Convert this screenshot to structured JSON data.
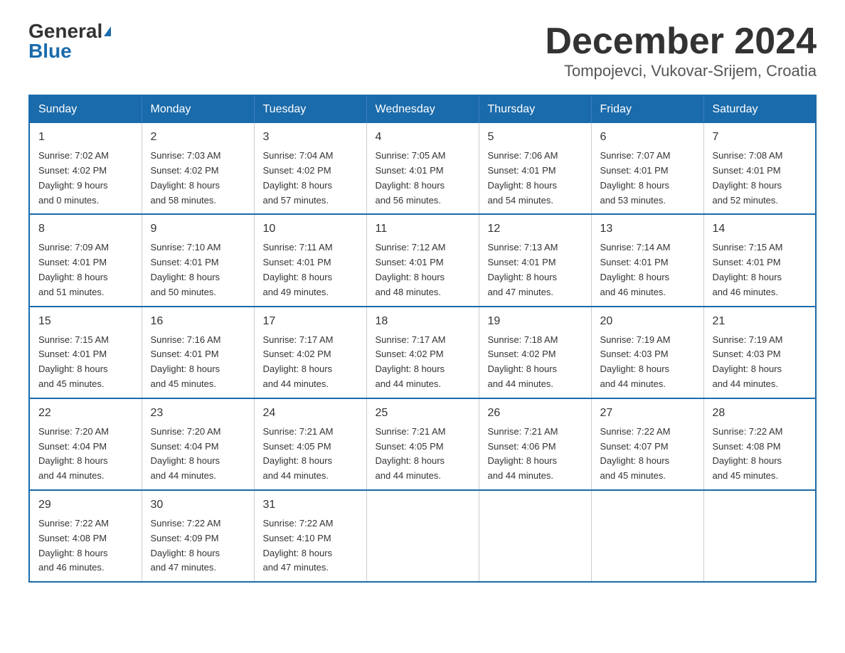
{
  "logo": {
    "general": "General",
    "blue": "Blue"
  },
  "title": "December 2024",
  "subtitle": "Tompojevci, Vukovar-Srijem, Croatia",
  "headers": [
    "Sunday",
    "Monday",
    "Tuesday",
    "Wednesday",
    "Thursday",
    "Friday",
    "Saturday"
  ],
  "weeks": [
    [
      {
        "day": "1",
        "sunrise": "Sunrise: 7:02 AM",
        "sunset": "Sunset: 4:02 PM",
        "daylight": "Daylight: 9 hours",
        "daylight2": "and 0 minutes."
      },
      {
        "day": "2",
        "sunrise": "Sunrise: 7:03 AM",
        "sunset": "Sunset: 4:02 PM",
        "daylight": "Daylight: 8 hours",
        "daylight2": "and 58 minutes."
      },
      {
        "day": "3",
        "sunrise": "Sunrise: 7:04 AM",
        "sunset": "Sunset: 4:02 PM",
        "daylight": "Daylight: 8 hours",
        "daylight2": "and 57 minutes."
      },
      {
        "day": "4",
        "sunrise": "Sunrise: 7:05 AM",
        "sunset": "Sunset: 4:01 PM",
        "daylight": "Daylight: 8 hours",
        "daylight2": "and 56 minutes."
      },
      {
        "day": "5",
        "sunrise": "Sunrise: 7:06 AM",
        "sunset": "Sunset: 4:01 PM",
        "daylight": "Daylight: 8 hours",
        "daylight2": "and 54 minutes."
      },
      {
        "day": "6",
        "sunrise": "Sunrise: 7:07 AM",
        "sunset": "Sunset: 4:01 PM",
        "daylight": "Daylight: 8 hours",
        "daylight2": "and 53 minutes."
      },
      {
        "day": "7",
        "sunrise": "Sunrise: 7:08 AM",
        "sunset": "Sunset: 4:01 PM",
        "daylight": "Daylight: 8 hours",
        "daylight2": "and 52 minutes."
      }
    ],
    [
      {
        "day": "8",
        "sunrise": "Sunrise: 7:09 AM",
        "sunset": "Sunset: 4:01 PM",
        "daylight": "Daylight: 8 hours",
        "daylight2": "and 51 minutes."
      },
      {
        "day": "9",
        "sunrise": "Sunrise: 7:10 AM",
        "sunset": "Sunset: 4:01 PM",
        "daylight": "Daylight: 8 hours",
        "daylight2": "and 50 minutes."
      },
      {
        "day": "10",
        "sunrise": "Sunrise: 7:11 AM",
        "sunset": "Sunset: 4:01 PM",
        "daylight": "Daylight: 8 hours",
        "daylight2": "and 49 minutes."
      },
      {
        "day": "11",
        "sunrise": "Sunrise: 7:12 AM",
        "sunset": "Sunset: 4:01 PM",
        "daylight": "Daylight: 8 hours",
        "daylight2": "and 48 minutes."
      },
      {
        "day": "12",
        "sunrise": "Sunrise: 7:13 AM",
        "sunset": "Sunset: 4:01 PM",
        "daylight": "Daylight: 8 hours",
        "daylight2": "and 47 minutes."
      },
      {
        "day": "13",
        "sunrise": "Sunrise: 7:14 AM",
        "sunset": "Sunset: 4:01 PM",
        "daylight": "Daylight: 8 hours",
        "daylight2": "and 46 minutes."
      },
      {
        "day": "14",
        "sunrise": "Sunrise: 7:15 AM",
        "sunset": "Sunset: 4:01 PM",
        "daylight": "Daylight: 8 hours",
        "daylight2": "and 46 minutes."
      }
    ],
    [
      {
        "day": "15",
        "sunrise": "Sunrise: 7:15 AM",
        "sunset": "Sunset: 4:01 PM",
        "daylight": "Daylight: 8 hours",
        "daylight2": "and 45 minutes."
      },
      {
        "day": "16",
        "sunrise": "Sunrise: 7:16 AM",
        "sunset": "Sunset: 4:01 PM",
        "daylight": "Daylight: 8 hours",
        "daylight2": "and 45 minutes."
      },
      {
        "day": "17",
        "sunrise": "Sunrise: 7:17 AM",
        "sunset": "Sunset: 4:02 PM",
        "daylight": "Daylight: 8 hours",
        "daylight2": "and 44 minutes."
      },
      {
        "day": "18",
        "sunrise": "Sunrise: 7:17 AM",
        "sunset": "Sunset: 4:02 PM",
        "daylight": "Daylight: 8 hours",
        "daylight2": "and 44 minutes."
      },
      {
        "day": "19",
        "sunrise": "Sunrise: 7:18 AM",
        "sunset": "Sunset: 4:02 PM",
        "daylight": "Daylight: 8 hours",
        "daylight2": "and 44 minutes."
      },
      {
        "day": "20",
        "sunrise": "Sunrise: 7:19 AM",
        "sunset": "Sunset: 4:03 PM",
        "daylight": "Daylight: 8 hours",
        "daylight2": "and 44 minutes."
      },
      {
        "day": "21",
        "sunrise": "Sunrise: 7:19 AM",
        "sunset": "Sunset: 4:03 PM",
        "daylight": "Daylight: 8 hours",
        "daylight2": "and 44 minutes."
      }
    ],
    [
      {
        "day": "22",
        "sunrise": "Sunrise: 7:20 AM",
        "sunset": "Sunset: 4:04 PM",
        "daylight": "Daylight: 8 hours",
        "daylight2": "and 44 minutes."
      },
      {
        "day": "23",
        "sunrise": "Sunrise: 7:20 AM",
        "sunset": "Sunset: 4:04 PM",
        "daylight": "Daylight: 8 hours",
        "daylight2": "and 44 minutes."
      },
      {
        "day": "24",
        "sunrise": "Sunrise: 7:21 AM",
        "sunset": "Sunset: 4:05 PM",
        "daylight": "Daylight: 8 hours",
        "daylight2": "and 44 minutes."
      },
      {
        "day": "25",
        "sunrise": "Sunrise: 7:21 AM",
        "sunset": "Sunset: 4:05 PM",
        "daylight": "Daylight: 8 hours",
        "daylight2": "and 44 minutes."
      },
      {
        "day": "26",
        "sunrise": "Sunrise: 7:21 AM",
        "sunset": "Sunset: 4:06 PM",
        "daylight": "Daylight: 8 hours",
        "daylight2": "and 44 minutes."
      },
      {
        "day": "27",
        "sunrise": "Sunrise: 7:22 AM",
        "sunset": "Sunset: 4:07 PM",
        "daylight": "Daylight: 8 hours",
        "daylight2": "and 45 minutes."
      },
      {
        "day": "28",
        "sunrise": "Sunrise: 7:22 AM",
        "sunset": "Sunset: 4:08 PM",
        "daylight": "Daylight: 8 hours",
        "daylight2": "and 45 minutes."
      }
    ],
    [
      {
        "day": "29",
        "sunrise": "Sunrise: 7:22 AM",
        "sunset": "Sunset: 4:08 PM",
        "daylight": "Daylight: 8 hours",
        "daylight2": "and 46 minutes."
      },
      {
        "day": "30",
        "sunrise": "Sunrise: 7:22 AM",
        "sunset": "Sunset: 4:09 PM",
        "daylight": "Daylight: 8 hours",
        "daylight2": "and 47 minutes."
      },
      {
        "day": "31",
        "sunrise": "Sunrise: 7:22 AM",
        "sunset": "Sunset: 4:10 PM",
        "daylight": "Daylight: 8 hours",
        "daylight2": "and 47 minutes."
      },
      null,
      null,
      null,
      null
    ]
  ]
}
